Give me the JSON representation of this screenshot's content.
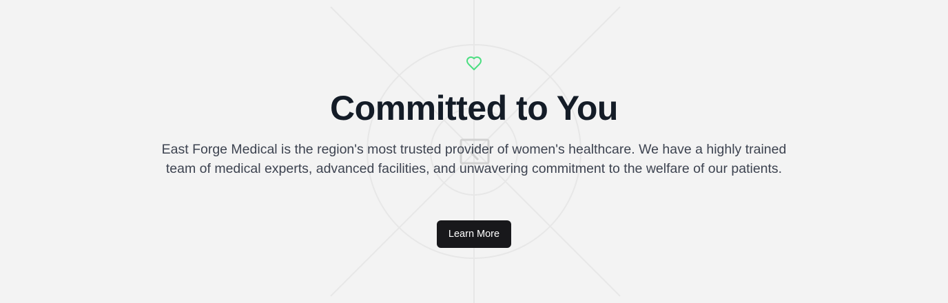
{
  "hero": {
    "icon": "heart-icon",
    "title": "Committed to You",
    "description": "East Forge Medical is the region's most trusted provider of women's healthcare. We have a highly trained team of medical experts, advanced facilities, and unwavering commitment to the welfare of our patients.",
    "button_label": "Learn More"
  },
  "colors": {
    "background": "#f3f3f3",
    "heading": "#141c27",
    "body_text": "#3d4350",
    "button_bg": "#18181b",
    "button_text": "#ffffff",
    "heart_accent": "#4ade80"
  }
}
